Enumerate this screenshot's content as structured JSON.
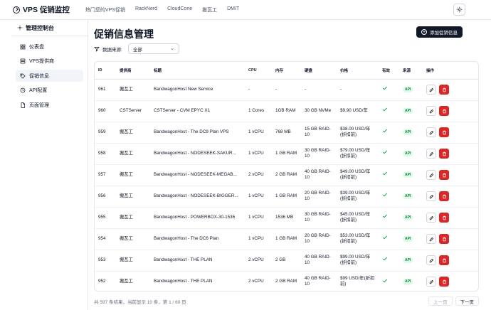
{
  "brand": {
    "title": "VPS 促销监控"
  },
  "topnav": {
    "links": [
      "热门您的VPS促销",
      "RackNerd",
      "CloudCone",
      "搬瓦工",
      "DMIT"
    ]
  },
  "sidebar": {
    "title": "管理控制台",
    "items": [
      {
        "label": "仪表盘",
        "icon": "dashboard-icon"
      },
      {
        "label": "VPS提供商",
        "icon": "server-icon"
      },
      {
        "label": "促销信息",
        "icon": "tag-icon"
      },
      {
        "label": "API配置",
        "icon": "api-icon"
      },
      {
        "label": "页面管理",
        "icon": "page-icon"
      }
    ],
    "active_index": 2
  },
  "main": {
    "title": "促销信息管理",
    "add_button": "添加促销信息",
    "filter_label": "数据来源:",
    "filter_value": "全部"
  },
  "table": {
    "headers": [
      "ID",
      "提供商",
      "标题",
      "CPU",
      "内存",
      "硬盘",
      "价格",
      "有效",
      "来源",
      "操作"
    ],
    "rows": [
      {
        "id": "961",
        "provider": "搬瓦工",
        "title": "BandwagonHost New Service",
        "cpu": "-",
        "ram": "-",
        "disk": "-",
        "price": "-",
        "source": "API"
      },
      {
        "id": "960",
        "provider": "CSTServer",
        "title": "CSTServer - CVM EPYC X1",
        "cpu": "1 Cores",
        "ram": "1GB RAM",
        "disk": "30 GB NVMe",
        "price": "$9.90 USD/年",
        "source": "API"
      },
      {
        "id": "959",
        "provider": "搬瓦工",
        "title": "BandwagonHost - The DC9 Plan VPS",
        "cpu": "1 vCPU",
        "ram": "768 MB",
        "disk": "15 GB RAID-10",
        "price": "$38.00 USD/年(折扣前)",
        "source": "API"
      },
      {
        "id": "958",
        "provider": "搬瓦工",
        "title": "BandwagonHost - NODESEEK-SAKUR...",
        "cpu": "1 vCPU",
        "ram": "1 GB RAM",
        "disk": "30 GB RAID-10",
        "price": "$79.00 USD/年(折扣前)",
        "source": "API"
      },
      {
        "id": "957",
        "provider": "搬瓦工",
        "title": "BandwagonHost - NODESEEK-MEGAB...",
        "cpu": "2 vCPU",
        "ram": "2 GB RAM",
        "disk": "40 GB RAID-10",
        "price": "$49.00 USD/年(折扣前)",
        "source": "API"
      },
      {
        "id": "956",
        "provider": "搬瓦工",
        "title": "BandwagonHost - NODESEEK-BIGGER...",
        "cpu": "1 vCPU",
        "ram": "1 GB RAM",
        "disk": "20 GB RAID-10",
        "price": "$39.00 USD/年(折扣前)",
        "source": "API"
      },
      {
        "id": "955",
        "provider": "搬瓦工",
        "title": "BandwagonHost - POWERBOX-30-1536",
        "cpu": "1 vCPU",
        "ram": "1536 MB",
        "disk": "30 GB RAID-10",
        "price": "$45.00 USD/年(折扣前)",
        "source": "API"
      },
      {
        "id": "954",
        "provider": "搬瓦工",
        "title": "BandwagonHost - The DC6 Plan",
        "cpu": "1 vCPU",
        "ram": "1 GB RAM",
        "disk": "20 GB RAID-10",
        "price": "$53.00 USD/年(折扣前)",
        "source": "API"
      },
      {
        "id": "953",
        "provider": "搬瓦工",
        "title": "BandwagonHost - THE PLAN",
        "cpu": "2 vCPU",
        "ram": "2 GB",
        "disk": "40 GB RAID-10",
        "price": "$99.00 USD/年(折扣前)",
        "source": "API"
      },
      {
        "id": "952",
        "provider": "搬瓦工",
        "title": "BandwagonHost - THE PLAN",
        "cpu": "2 vCPU",
        "ram": "2 GB RAM",
        "disk": "40 GB RAID-10",
        "price": "$99 USD/年(折扣前)",
        "source": "API"
      }
    ]
  },
  "footer": {
    "info": "共 597 条结果，当前显示 10 条，第 1 / 60 页",
    "prev": "上一页",
    "next": "下一页"
  },
  "colors": {
    "primary": "#111827",
    "danger": "#dc2626",
    "success": "#16a34a",
    "badge_bg": "#dcfce7"
  }
}
